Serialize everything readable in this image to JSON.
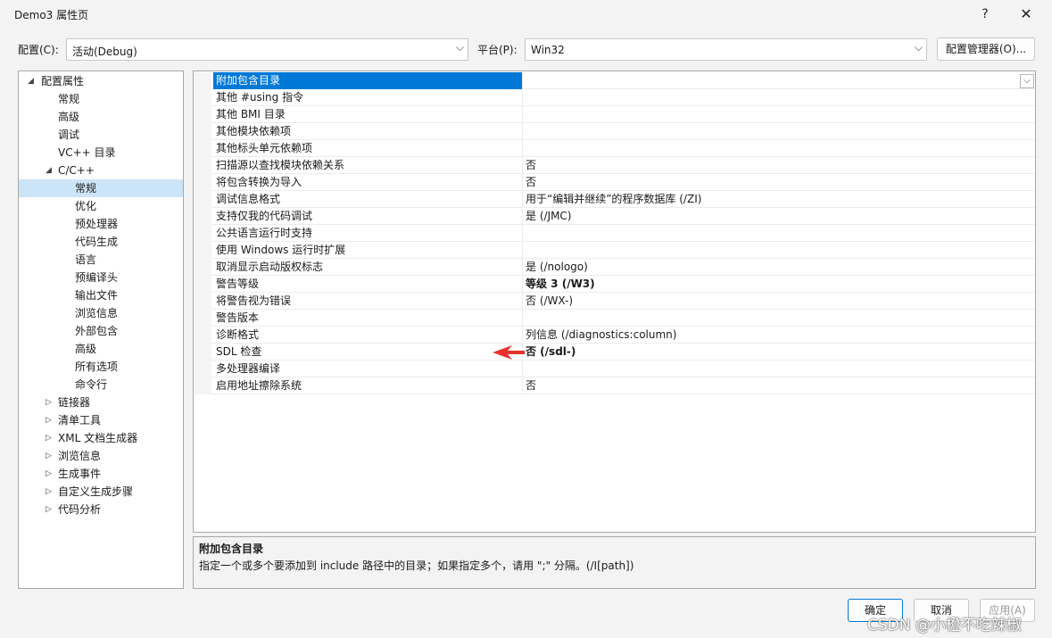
{
  "window": {
    "title": "Demo3 属性页",
    "help_icon": "?",
    "close_icon": "✕"
  },
  "config": {
    "config_label": "配置(C):",
    "config_value": "活动(Debug)",
    "platform_label": "平台(P):",
    "platform_value": "Win32",
    "manager_button": "配置管理器(O)..."
  },
  "tree": {
    "items": [
      {
        "label": "配置属性",
        "arrow": "◢",
        "level": 0
      },
      {
        "label": "常规",
        "arrow": "",
        "level": 1
      },
      {
        "label": "高级",
        "arrow": "",
        "level": 1
      },
      {
        "label": "调试",
        "arrow": "",
        "level": 1
      },
      {
        "label": "VC++ 目录",
        "arrow": "",
        "level": 1
      },
      {
        "label": "C/C++",
        "arrow": "◢",
        "level": 1
      },
      {
        "label": "常规",
        "arrow": "",
        "level": 2,
        "selected": true
      },
      {
        "label": "优化",
        "arrow": "",
        "level": 2
      },
      {
        "label": "预处理器",
        "arrow": "",
        "level": 2
      },
      {
        "label": "代码生成",
        "arrow": "",
        "level": 2
      },
      {
        "label": "语言",
        "arrow": "",
        "level": 2
      },
      {
        "label": "预编译头",
        "arrow": "",
        "level": 2
      },
      {
        "label": "输出文件",
        "arrow": "",
        "level": 2
      },
      {
        "label": "浏览信息",
        "arrow": "",
        "level": 2
      },
      {
        "label": "外部包含",
        "arrow": "",
        "level": 2
      },
      {
        "label": "高级",
        "arrow": "",
        "level": 2
      },
      {
        "label": "所有选项",
        "arrow": "",
        "level": 2
      },
      {
        "label": "命令行",
        "arrow": "",
        "level": 2
      },
      {
        "label": "链接器",
        "arrow": "▷",
        "level": 1
      },
      {
        "label": "清单工具",
        "arrow": "▷",
        "level": 1
      },
      {
        "label": "XML 文档生成器",
        "arrow": "▷",
        "level": 1
      },
      {
        "label": "浏览信息",
        "arrow": "▷",
        "level": 1
      },
      {
        "label": "生成事件",
        "arrow": "▷",
        "level": 1
      },
      {
        "label": "自定义生成步骤",
        "arrow": "▷",
        "level": 1
      },
      {
        "label": "代码分析",
        "arrow": "▷",
        "level": 1
      }
    ]
  },
  "properties": {
    "rows": [
      {
        "name": "附加包含目录",
        "value": "",
        "selected": true
      },
      {
        "name": "其他 #using 指令",
        "value": ""
      },
      {
        "name": "其他 BMI 目录",
        "value": ""
      },
      {
        "name": "其他模块依赖项",
        "value": ""
      },
      {
        "name": "其他标头单元依赖项",
        "value": ""
      },
      {
        "name": "扫描源以查找模块依赖关系",
        "value": "否"
      },
      {
        "name": "将包含转换为导入",
        "value": "否"
      },
      {
        "name": "调试信息格式",
        "value": "用于“编辑并继续”的程序数据库 (/ZI)"
      },
      {
        "name": "支持仅我的代码调试",
        "value": "是 (/JMC)"
      },
      {
        "name": "公共语言运行时支持",
        "value": ""
      },
      {
        "name": "使用 Windows 运行时扩展",
        "value": ""
      },
      {
        "name": "取消显示启动版权标志",
        "value": "是 (/nologo)"
      },
      {
        "name": "警告等级",
        "value": "等级 3 (/W3)",
        "bold": true
      },
      {
        "name": "将警告视为错误",
        "value": "否 (/WX-)"
      },
      {
        "name": "警告版本",
        "value": ""
      },
      {
        "name": "诊断格式",
        "value": "列信息 (/diagnostics:column)"
      },
      {
        "name": "SDL 检查",
        "value": "否 (/sdl-)",
        "bold": true
      },
      {
        "name": "多处理器编译",
        "value": ""
      },
      {
        "name": "启用地址擦除系统",
        "value": "否"
      }
    ]
  },
  "description": {
    "title": "附加包含目录",
    "body": "指定一个或多个要添加到 include 路径中的目录；如果指定多个，请用 \";\" 分隔。(/I[path])"
  },
  "footer": {
    "ok": "确定",
    "cancel": "取消",
    "apply": "应用(A)"
  },
  "watermark": "CSDN @小橙不吃辣椒",
  "colors": {
    "accent": "#0078d7",
    "tree_selection": "#cce4f7",
    "arrow": "#e8322d"
  }
}
